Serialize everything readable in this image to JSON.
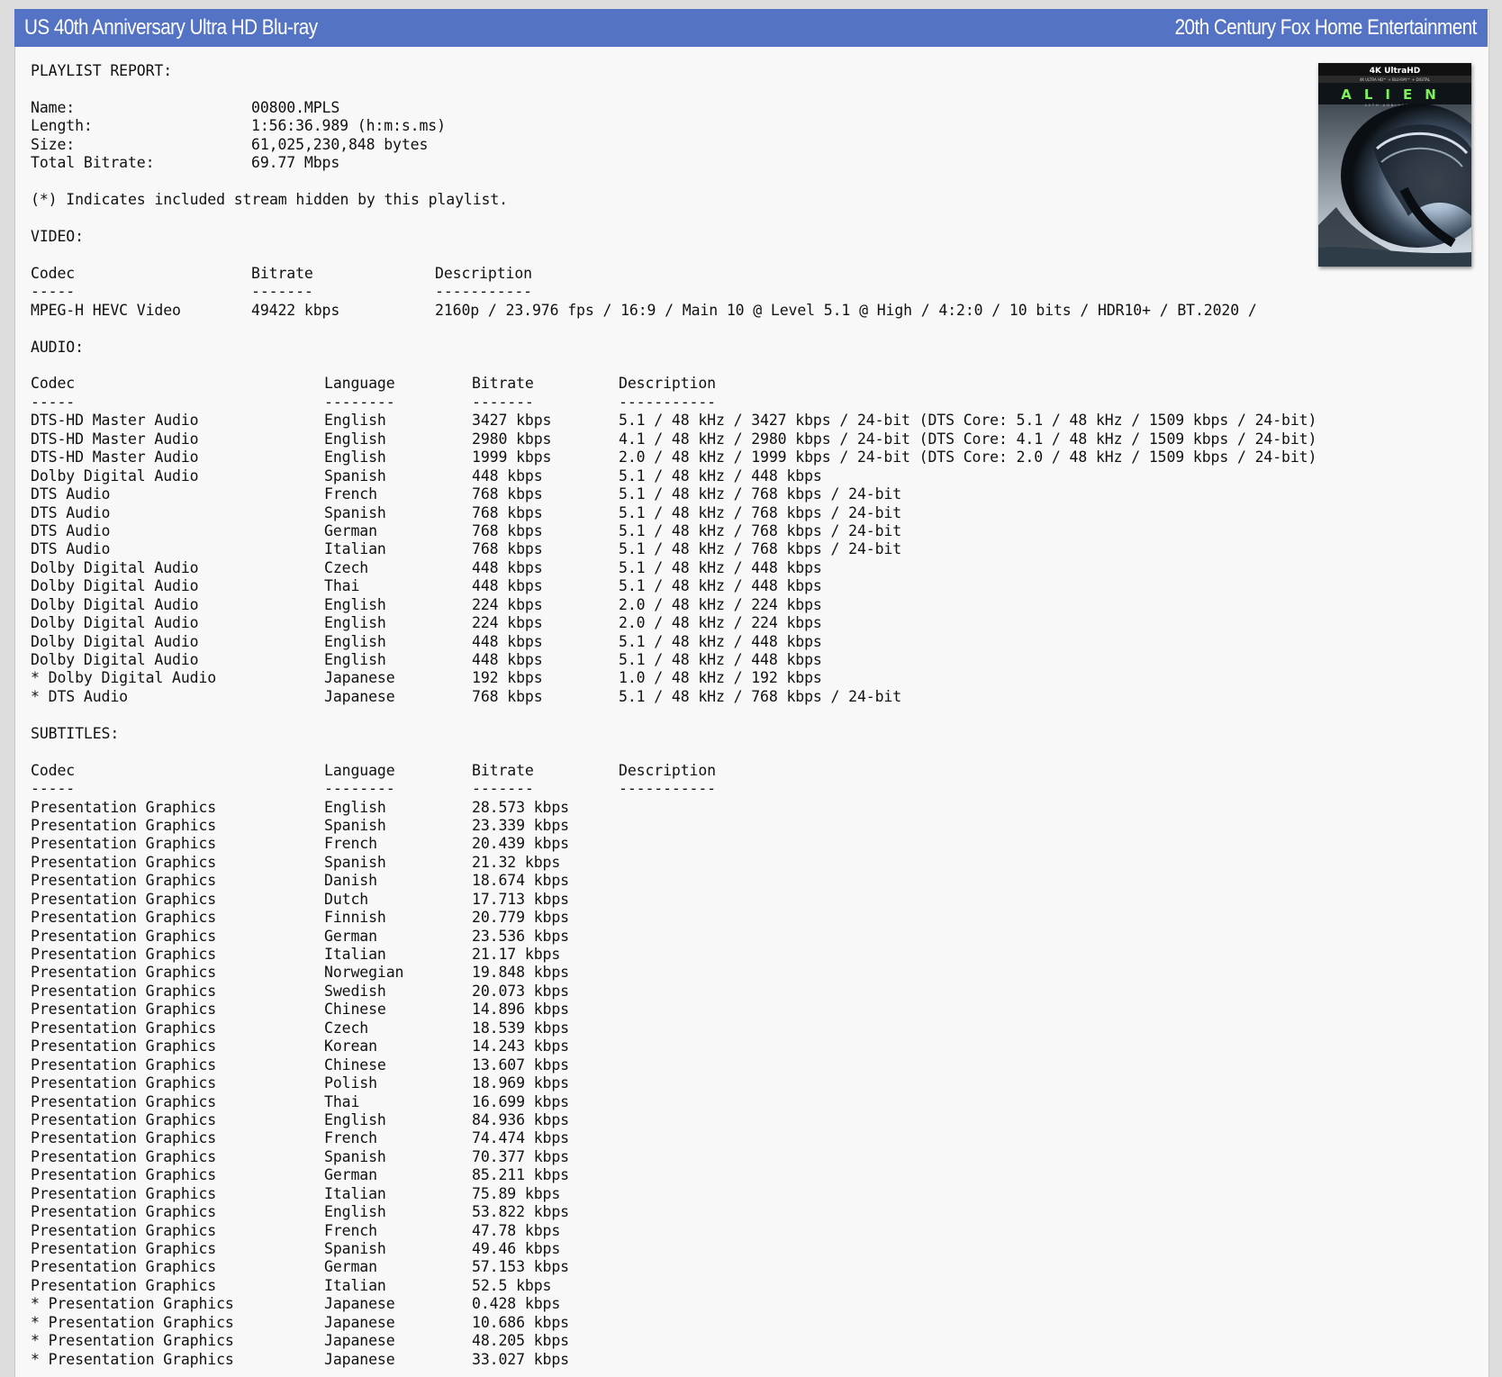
{
  "header": {
    "left_title": "US 40th Anniversary Ultra HD Blu-ray",
    "right_title": "20th Century Fox Home Entertainment"
  },
  "cover": {
    "top_banner": "4K UltraHD",
    "sub_banner": "4K ULTRA HD™ + BLU-RAY™ + DIGITAL",
    "movie_title": "ALIEN",
    "subtitle": "40TH ANNIVERSARY"
  },
  "report": {
    "heading": "PLAYLIST REPORT:",
    "info": [
      {
        "label": "Name:",
        "value": "00800.MPLS"
      },
      {
        "label": "Length:",
        "value": "1:56:36.989 (h:m:s.ms)"
      },
      {
        "label": "Size:",
        "value": "61,025,230,848 bytes"
      },
      {
        "label": "Total Bitrate:",
        "value": "69.77 Mbps"
      }
    ],
    "note": "(*) Indicates included stream hidden by this playlist.",
    "video": {
      "heading": "VIDEO:",
      "headers": {
        "codec": "Codec",
        "bitrate": "Bitrate",
        "description": "Description"
      },
      "dashes": {
        "codec": "-----",
        "bitrate": "-------",
        "description": "-----------"
      },
      "rows": [
        {
          "codec": "MPEG-H HEVC Video",
          "bitrate": "49422 kbps",
          "description": "2160p / 23.976 fps / 16:9 / Main 10 @ Level 5.1 @ High / 4:2:0 / 10 bits / HDR10+ / BT.2020 /"
        }
      ]
    },
    "audio": {
      "heading": "AUDIO:",
      "headers": {
        "codec": "Codec",
        "language": "Language",
        "bitrate": "Bitrate",
        "description": "Description"
      },
      "dashes": {
        "codec": "-----",
        "language": "--------",
        "bitrate": "-------",
        "description": "-----------"
      },
      "rows": [
        {
          "codec": "DTS-HD Master Audio",
          "language": "English",
          "bitrate": "3427 kbps",
          "description": "5.1 / 48 kHz / 3427 kbps / 24-bit (DTS Core: 5.1 / 48 kHz / 1509 kbps / 24-bit)"
        },
        {
          "codec": "DTS-HD Master Audio",
          "language": "English",
          "bitrate": "2980 kbps",
          "description": "4.1 / 48 kHz / 2980 kbps / 24-bit (DTS Core: 4.1 / 48 kHz / 1509 kbps / 24-bit)"
        },
        {
          "codec": "DTS-HD Master Audio",
          "language": "English",
          "bitrate": "1999 kbps",
          "description": "2.0 / 48 kHz / 1999 kbps / 24-bit (DTS Core: 2.0 / 48 kHz / 1509 kbps / 24-bit)"
        },
        {
          "codec": "Dolby Digital Audio",
          "language": "Spanish",
          "bitrate": "448 kbps",
          "description": "5.1 / 48 kHz / 448 kbps"
        },
        {
          "codec": "DTS Audio",
          "language": "French",
          "bitrate": "768 kbps",
          "description": "5.1 / 48 kHz / 768 kbps / 24-bit"
        },
        {
          "codec": "DTS Audio",
          "language": "Spanish",
          "bitrate": "768 kbps",
          "description": "5.1 / 48 kHz / 768 kbps / 24-bit"
        },
        {
          "codec": "DTS Audio",
          "language": "German",
          "bitrate": "768 kbps",
          "description": "5.1 / 48 kHz / 768 kbps / 24-bit"
        },
        {
          "codec": "DTS Audio",
          "language": "Italian",
          "bitrate": "768 kbps",
          "description": "5.1 / 48 kHz / 768 kbps / 24-bit"
        },
        {
          "codec": "Dolby Digital Audio",
          "language": "Czech",
          "bitrate": "448 kbps",
          "description": "5.1 / 48 kHz / 448 kbps"
        },
        {
          "codec": "Dolby Digital Audio",
          "language": "Thai",
          "bitrate": "448 kbps",
          "description": "5.1 / 48 kHz / 448 kbps"
        },
        {
          "codec": "Dolby Digital Audio",
          "language": "English",
          "bitrate": "224 kbps",
          "description": "2.0 / 48 kHz / 224 kbps"
        },
        {
          "codec": "Dolby Digital Audio",
          "language": "English",
          "bitrate": "224 kbps",
          "description": "2.0 / 48 kHz / 224 kbps"
        },
        {
          "codec": "Dolby Digital Audio",
          "language": "English",
          "bitrate": "448 kbps",
          "description": "5.1 / 48 kHz / 448 kbps"
        },
        {
          "codec": "Dolby Digital Audio",
          "language": "English",
          "bitrate": "448 kbps",
          "description": "5.1 / 48 kHz / 448 kbps"
        },
        {
          "codec": "* Dolby Digital Audio",
          "language": "Japanese",
          "bitrate": "192 kbps",
          "description": "1.0 / 48 kHz / 192 kbps"
        },
        {
          "codec": "* DTS Audio",
          "language": "Japanese",
          "bitrate": "768 kbps",
          "description": "5.1 / 48 kHz / 768 kbps / 24-bit"
        }
      ]
    },
    "subtitles": {
      "heading": "SUBTITLES:",
      "headers": {
        "codec": "Codec",
        "language": "Language",
        "bitrate": "Bitrate",
        "description": "Description"
      },
      "dashes": {
        "codec": "-----",
        "language": "--------",
        "bitrate": "-------",
        "description": "-----------"
      },
      "rows": [
        {
          "codec": "Presentation Graphics",
          "language": "English",
          "bitrate": "28.573 kbps"
        },
        {
          "codec": "Presentation Graphics",
          "language": "Spanish",
          "bitrate": "23.339 kbps"
        },
        {
          "codec": "Presentation Graphics",
          "language": "French",
          "bitrate": "20.439 kbps"
        },
        {
          "codec": "Presentation Graphics",
          "language": "Spanish",
          "bitrate": "21.32 kbps"
        },
        {
          "codec": "Presentation Graphics",
          "language": "Danish",
          "bitrate": "18.674 kbps"
        },
        {
          "codec": "Presentation Graphics",
          "language": "Dutch",
          "bitrate": "17.713 kbps"
        },
        {
          "codec": "Presentation Graphics",
          "language": "Finnish",
          "bitrate": "20.779 kbps"
        },
        {
          "codec": "Presentation Graphics",
          "language": "German",
          "bitrate": "23.536 kbps"
        },
        {
          "codec": "Presentation Graphics",
          "language": "Italian",
          "bitrate": "21.17 kbps"
        },
        {
          "codec": "Presentation Graphics",
          "language": "Norwegian",
          "bitrate": "19.848 kbps"
        },
        {
          "codec": "Presentation Graphics",
          "language": "Swedish",
          "bitrate": "20.073 kbps"
        },
        {
          "codec": "Presentation Graphics",
          "language": "Chinese",
          "bitrate": "14.896 kbps"
        },
        {
          "codec": "Presentation Graphics",
          "language": "Czech",
          "bitrate": "18.539 kbps"
        },
        {
          "codec": "Presentation Graphics",
          "language": "Korean",
          "bitrate": "14.243 kbps"
        },
        {
          "codec": "Presentation Graphics",
          "language": "Chinese",
          "bitrate": "13.607 kbps"
        },
        {
          "codec": "Presentation Graphics",
          "language": "Polish",
          "bitrate": "18.969 kbps"
        },
        {
          "codec": "Presentation Graphics",
          "language": "Thai",
          "bitrate": "16.699 kbps"
        },
        {
          "codec": "Presentation Graphics",
          "language": "English",
          "bitrate": "84.936 kbps"
        },
        {
          "codec": "Presentation Graphics",
          "language": "French",
          "bitrate": "74.474 kbps"
        },
        {
          "codec": "Presentation Graphics",
          "language": "Spanish",
          "bitrate": "70.377 kbps"
        },
        {
          "codec": "Presentation Graphics",
          "language": "German",
          "bitrate": "85.211 kbps"
        },
        {
          "codec": "Presentation Graphics",
          "language": "Italian",
          "bitrate": "75.89 kbps"
        },
        {
          "codec": "Presentation Graphics",
          "language": "English",
          "bitrate": "53.822 kbps"
        },
        {
          "codec": "Presentation Graphics",
          "language": "French",
          "bitrate": "47.78 kbps"
        },
        {
          "codec": "Presentation Graphics",
          "language": "Spanish",
          "bitrate": "49.46 kbps"
        },
        {
          "codec": "Presentation Graphics",
          "language": "German",
          "bitrate": "57.153 kbps"
        },
        {
          "codec": "Presentation Graphics",
          "language": "Italian",
          "bitrate": "52.5 kbps"
        },
        {
          "codec": "* Presentation Graphics",
          "language": "Japanese",
          "bitrate": "0.428 kbps"
        },
        {
          "codec": "* Presentation Graphics",
          "language": "Japanese",
          "bitrate": "10.686 kbps"
        },
        {
          "codec": "* Presentation Graphics",
          "language": "Japanese",
          "bitrate": "48.205 kbps"
        },
        {
          "codec": "* Presentation Graphics",
          "language": "Japanese",
          "bitrate": "33.027 kbps"
        }
      ]
    }
  }
}
